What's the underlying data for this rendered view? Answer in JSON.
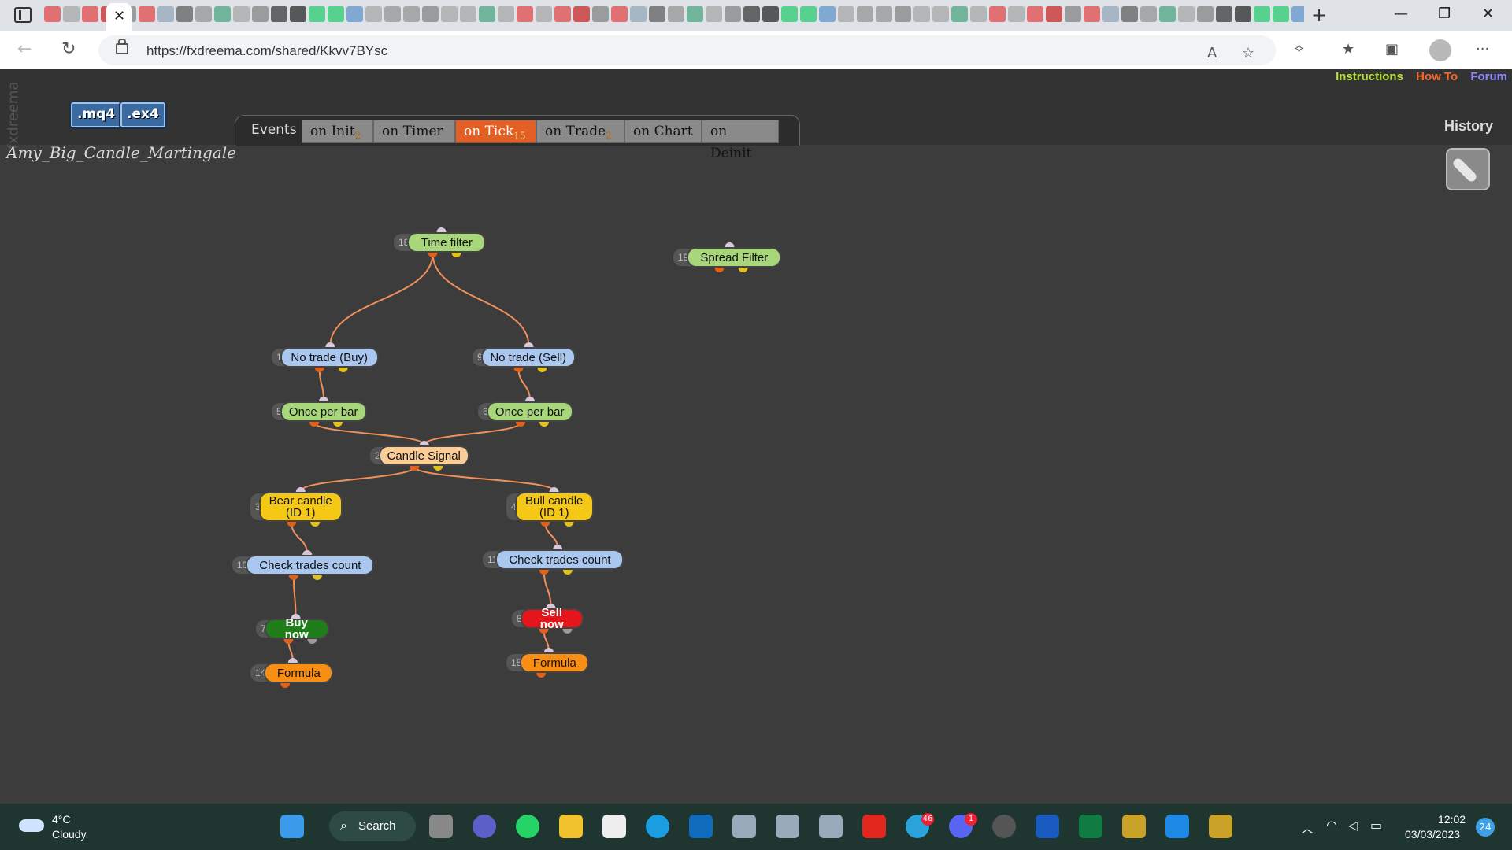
{
  "browser": {
    "url": "https://fxdreema.com/shared/Kkvv7BYsc",
    "tab_close": "✕",
    "newtab": "+"
  },
  "page": {
    "side_logo": "fxdreema",
    "buttons": {
      "mq4": ".mq4",
      "ex4": ".ex4"
    },
    "project_title": "Amy_Big_Candle_Martingale",
    "events_label": "Events",
    "tabs": [
      {
        "label": "on Init",
        "count": "2",
        "active": false
      },
      {
        "label": "on Timer",
        "count": "",
        "active": false
      },
      {
        "label": "on Tick",
        "count": "15",
        "active": true
      },
      {
        "label": "on Trade",
        "count": "2",
        "active": false
      },
      {
        "label": "on Chart",
        "count": "",
        "active": false
      },
      {
        "label": "on Deinit",
        "count": "",
        "active": false
      }
    ],
    "links": {
      "instructions": "Instructions",
      "howto": "How To",
      "forum": "Forum"
    },
    "links_colors": {
      "instructions": "#b6e13a",
      "howto": "#f36a2a",
      "forum": "#8c8cff"
    },
    "history": "History"
  },
  "blocks": [
    {
      "id": "18",
      "label": "Time filter",
      "color": "green"
    },
    {
      "id": "19",
      "label": "Spread Filter",
      "color": "green"
    },
    {
      "id": "1",
      "label": "No trade (Buy)",
      "color": "blue"
    },
    {
      "id": "9",
      "label": "No trade (Sell)",
      "color": "blue"
    },
    {
      "id": "5",
      "label": "Once per bar",
      "color": "green"
    },
    {
      "id": "6",
      "label": "Once per bar",
      "color": "green"
    },
    {
      "id": "2",
      "label": "Candle Signal",
      "color": "peach"
    },
    {
      "id": "3",
      "label": "Bear candle (ID 1)",
      "color": "yellow"
    },
    {
      "id": "4",
      "label": "Bull candle (ID 1)",
      "color": "yellow"
    },
    {
      "id": "10",
      "label": "Check trades count",
      "color": "blue"
    },
    {
      "id": "11",
      "label": "Check trades count",
      "color": "blue"
    },
    {
      "id": "7",
      "label": "Buy now",
      "color": "darkgreen"
    },
    {
      "id": "8",
      "label": "Sell now",
      "color": "red"
    },
    {
      "id": "14",
      "label": "Formula",
      "color": "orange"
    },
    {
      "id": "15",
      "label": "Formula",
      "color": "orange"
    }
  ],
  "connections": [
    [
      "18",
      "1"
    ],
    [
      "18",
      "9"
    ],
    [
      "1",
      "5"
    ],
    [
      "9",
      "6"
    ],
    [
      "5",
      "2"
    ],
    [
      "6",
      "2"
    ],
    [
      "2",
      "3"
    ],
    [
      "2",
      "4"
    ],
    [
      "3",
      "10"
    ],
    [
      "4",
      "11"
    ],
    [
      "10",
      "7"
    ],
    [
      "11",
      "8"
    ],
    [
      "7",
      "14"
    ],
    [
      "8",
      "15"
    ]
  ],
  "taskbar": {
    "temp": "4°C",
    "condition": "Cloudy",
    "search": "Search",
    "time": "12:02",
    "date": "03/03/2023",
    "notifications": "24",
    "badges": {
      "telegram": "46",
      "discord": "1"
    }
  }
}
